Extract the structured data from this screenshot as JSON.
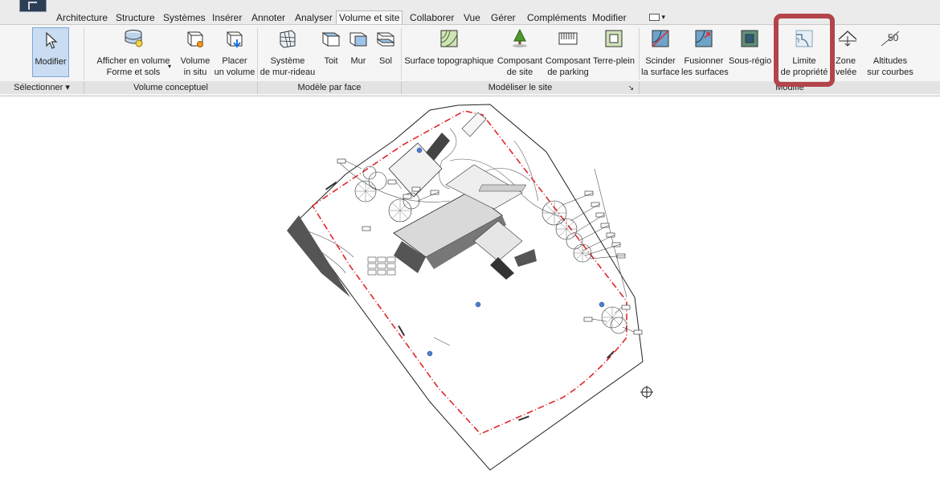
{
  "tabs": [
    {
      "label": "Architecture"
    },
    {
      "label": "Structure"
    },
    {
      "label": "Systèmes"
    },
    {
      "label": "Insérer"
    },
    {
      "label": "Annoter"
    },
    {
      "label": "Analyser"
    },
    {
      "label": "Volume et site",
      "active": true
    },
    {
      "label": "Collaborer"
    },
    {
      "label": "Vue"
    },
    {
      "label": "Gérer"
    },
    {
      "label": "Compléments"
    },
    {
      "label": "Modifier"
    }
  ],
  "ribbon": {
    "modifier": {
      "label": "Modifier"
    },
    "afficher_volume": {
      "line1": "Afficher en volume",
      "line2": "Forme et sols"
    },
    "volume_in_situ": {
      "line1": "Volume",
      "line2": "in situ"
    },
    "placer_volume": {
      "line1": "Placer",
      "line2": "un volume"
    },
    "systeme_mur_rideau": {
      "line1": "Système",
      "line2": "de mur-rideau"
    },
    "toit": {
      "label": "Toit"
    },
    "mur": {
      "label": "Mur"
    },
    "sol": {
      "label": "Sol"
    },
    "surface_topo": {
      "label": "Surface topographique"
    },
    "composant_site": {
      "line1": "Composant",
      "line2": "de site"
    },
    "composant_parking": {
      "line1": "Composant",
      "line2": "de parking"
    },
    "terre_plein": {
      "label": "Terre-plein"
    },
    "scinder": {
      "line1": "Scinder",
      "line2": "la surface"
    },
    "fusionner": {
      "line1": "Fusionner",
      "line2": "les surfaces"
    },
    "sous_region": {
      "label": "Sous-régio"
    },
    "limite_propriete": {
      "line1": "Limite",
      "line2": "de propriété"
    },
    "zone_nivelee": {
      "line1": "Zone",
      "line2": "velée"
    },
    "altitudes": {
      "line1": "Altitudes",
      "line2": "sur courbes"
    }
  },
  "panels": {
    "selectionner": "Sélectionner",
    "volume_conceptuel": "Volume conceptuel",
    "modele_par_face": "Modèle par face",
    "modeliser_site": "Modéliser le site",
    "modifier_site": "Modifie"
  },
  "colors": {
    "highlight": "#b3444a",
    "property_line": "#e0262b",
    "active_button_bg": "#c9dcf1"
  }
}
